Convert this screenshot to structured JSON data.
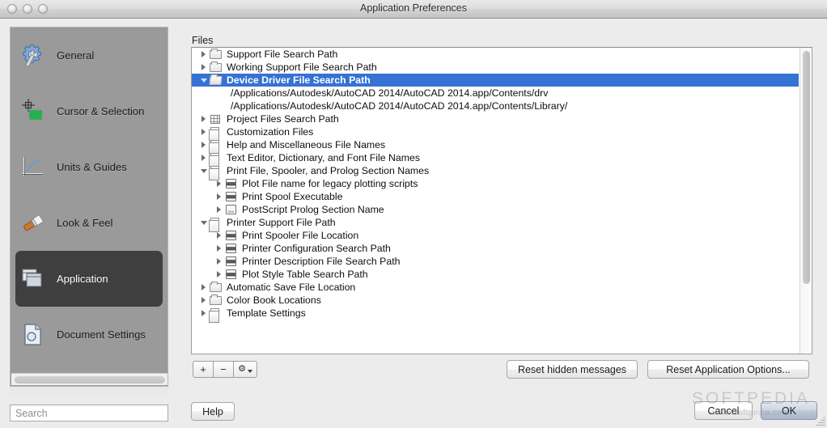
{
  "window": {
    "title": "Application Preferences",
    "traffic_lights": [
      "close-button",
      "minimize-button",
      "zoom-button"
    ]
  },
  "sidebar": {
    "items": [
      {
        "label": "General",
        "icon": "gear-wrench-icon",
        "selected": false
      },
      {
        "label": "Cursor & Selection",
        "icon": "crosshair-marquee-icon",
        "selected": false
      },
      {
        "label": "Units & Guides",
        "icon": "ruler-axis-icon",
        "selected": false
      },
      {
        "label": "Look & Feel",
        "icon": "paintbrush-icon",
        "selected": false
      },
      {
        "label": "Application",
        "icon": "windows-stack-icon",
        "selected": true
      },
      {
        "label": "Document Settings",
        "icon": "document-icon",
        "selected": false
      }
    ]
  },
  "search": {
    "placeholder": "Search",
    "value": ""
  },
  "main": {
    "group_label": "Files",
    "tree": [
      {
        "indent": 0,
        "label": "Support File Search Path",
        "icon": "folder-icon",
        "state": "closed",
        "selected": false
      },
      {
        "indent": 0,
        "label": "Working Support File Search Path",
        "icon": "folder-icon",
        "state": "closed",
        "selected": false
      },
      {
        "indent": 0,
        "label": "Device Driver File Search Path",
        "icon": "folder-open-icon",
        "state": "open",
        "selected": true
      },
      {
        "indent": 2,
        "label": "/Applications/Autodesk/AutoCAD 2014/AutoCAD 2014.app/Contents/drv",
        "icon": "none",
        "state": "leaf",
        "selected": false
      },
      {
        "indent": 2,
        "label": "/Applications/Autodesk/AutoCAD 2014/AutoCAD 2014.app/Contents/Library/",
        "icon": "none",
        "state": "leaf",
        "selected": false
      },
      {
        "indent": 0,
        "label": "Project Files Search Path",
        "icon": "grid-icon",
        "state": "closed",
        "selected": false
      },
      {
        "indent": 0,
        "label": "Customization Files",
        "icon": "documents-icon",
        "state": "closed",
        "selected": false
      },
      {
        "indent": 0,
        "label": "Help and Miscellaneous File Names",
        "icon": "documents-icon",
        "state": "closed",
        "selected": false
      },
      {
        "indent": 0,
        "label": "Text Editor, Dictionary, and Font File Names",
        "icon": "documents-icon",
        "state": "closed",
        "selected": false
      },
      {
        "indent": 0,
        "label": "Print File, Spooler, and Prolog Section Names",
        "icon": "documents-icon",
        "state": "open",
        "selected": false
      },
      {
        "indent": 1,
        "label": "Plot File name for legacy plotting scripts",
        "icon": "printer-icon",
        "state": "closed",
        "selected": false
      },
      {
        "indent": 1,
        "label": "Print Spool Executable",
        "icon": "printer-icon",
        "state": "closed",
        "selected": false
      },
      {
        "indent": 1,
        "label": "PostScript Prolog Section Name",
        "icon": "shx-file-icon",
        "state": "closed",
        "selected": false
      },
      {
        "indent": 0,
        "label": "Printer Support File Path",
        "icon": "documents-icon",
        "state": "open",
        "selected": false
      },
      {
        "indent": 1,
        "label": "Print Spooler File Location",
        "icon": "printer-icon",
        "state": "closed",
        "selected": false
      },
      {
        "indent": 1,
        "label": "Printer Configuration Search Path",
        "icon": "printer-icon",
        "state": "closed",
        "selected": false
      },
      {
        "indent": 1,
        "label": "Printer Description File Search Path",
        "icon": "printer-icon",
        "state": "closed",
        "selected": false
      },
      {
        "indent": 1,
        "label": "Plot Style Table Search Path",
        "icon": "printer-icon",
        "state": "closed",
        "selected": false
      },
      {
        "indent": 0,
        "label": "Automatic Save File Location",
        "icon": "folder-icon",
        "state": "closed",
        "selected": false
      },
      {
        "indent": 0,
        "label": "Color Book Locations",
        "icon": "folder-icon",
        "state": "closed",
        "selected": false
      },
      {
        "indent": 0,
        "label": "Template Settings",
        "icon": "documents-icon",
        "state": "closed",
        "selected": false
      }
    ]
  },
  "toolbar": {
    "add_label": "+",
    "remove_label": "−",
    "gear_label": "⚙"
  },
  "buttons": {
    "reset_hidden_messages": "Reset hidden messages",
    "reset_application_options": "Reset Application Options...",
    "help": "Help",
    "cancel": "Cancel",
    "ok": "OK"
  },
  "watermark": {
    "big": "SOFTPEDIA",
    "small": "www.softpedia.com"
  },
  "colors": {
    "selection_blue": "#3572d4",
    "sidebar_bg": "#9a9a9a",
    "sidebar_selected": "#3f3f3f",
    "window_bg": "#ececec",
    "default_button": "#aab7c9"
  }
}
